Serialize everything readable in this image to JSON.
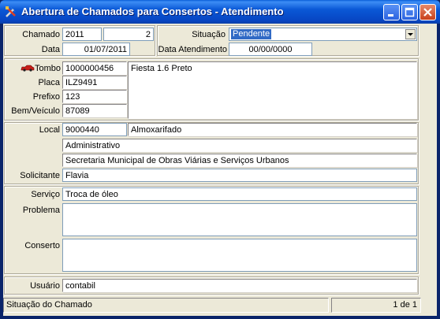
{
  "window": {
    "title": "Abertura de Chamados para Consertos - Atendimento"
  },
  "header": {
    "chamado_label": "Chamado",
    "chamado_ano": "2011",
    "chamado_numero": "2",
    "data_label": "Data",
    "data_value": "01/07/2011",
    "situacao_label": "Situação",
    "situacao_value": "Pendente",
    "data_atendimento_label": "Data Atendimento",
    "data_atendimento_value": "00/00/0000"
  },
  "veiculo": {
    "tombo_label": "Tombo",
    "tombo_value": "1000000456",
    "descricao": "Fiesta 1.6 Preto",
    "placa_label": "Placa",
    "placa_value": "ILZ9491",
    "prefixo_label": "Prefixo",
    "prefixo_value": "123",
    "bem_label": "Bem/Veículo",
    "bem_value": "87089"
  },
  "local": {
    "local_label": "Local",
    "local_code": "9000440",
    "local_name": "Almoxarifado",
    "linha2": "Administrativo",
    "linha3": "Secretaria Municipal de Obras Viárias e Serviços Urbanos",
    "solicitante_label": "Solicitante",
    "solicitante_value": "Flavia"
  },
  "servico": {
    "servico_label": "Serviço",
    "servico_value": "Troca de óleo",
    "problema_label": "Problema",
    "problema_value": "",
    "conserto_label": "Conserto",
    "conserto_value": ""
  },
  "usuario": {
    "label": "Usuário",
    "value": "contabil"
  },
  "statusbar": {
    "text": "Situação do Chamado",
    "record": "1 de 1"
  },
  "colors": {
    "title_bar": "#0a58d6",
    "selection": "#316ac5",
    "face": "#ece9d8"
  },
  "icons": [
    "tools-icon",
    "minimize-icon",
    "maximize-icon",
    "close-icon",
    "car-icon",
    "chevron-down-icon"
  ]
}
